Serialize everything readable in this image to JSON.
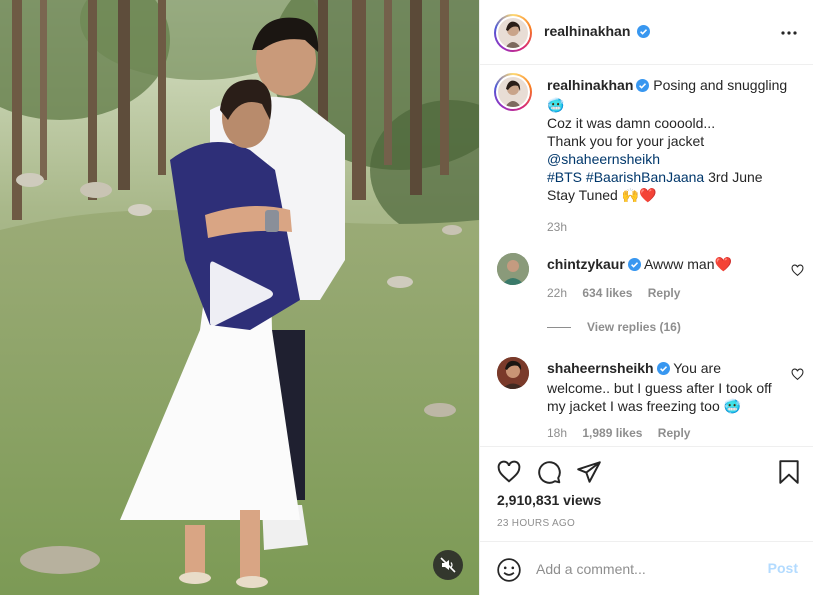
{
  "post": {
    "username": "realhinakhan",
    "verified": true,
    "more_icon": "more-options-icon"
  },
  "caption": {
    "username": "realhinakhan",
    "line1": "Posing and snuggling 🥶",
    "line2": "Coz it was damn coooold...",
    "line3": "Thank you for your jacket",
    "mention": "@shaheernsheikh",
    "hashtag1": "#BTS",
    "hashtag2": "#BaarishBanJaana",
    "line5_rest": "3rd June",
    "line6": "Stay Tuned 🙌❤️",
    "time": "23h"
  },
  "comments": [
    {
      "username": "chintzykaur",
      "text": "Awww man❤️",
      "time": "22h",
      "likes": "634 likes",
      "reply": "Reply",
      "view_replies": "View replies (16)"
    },
    {
      "username": "shaheernsheikh",
      "text": "You are welcome.. but I guess after I took off my jacket I was freezing too 🥶",
      "time": "18h",
      "likes": "1,989 likes",
      "reply": "Reply"
    }
  ],
  "stats": {
    "views": "2,910,831 views",
    "posted": "23 HOURS AGO"
  },
  "add_comment": {
    "placeholder": "Add a comment...",
    "post_label": "Post"
  },
  "colors": {
    "link": "#00376b",
    "secondary_text": "#8e8e8e",
    "verified_blue": "#3897f0",
    "post_disabled": "#b3dbff",
    "divider": "#efefef"
  }
}
